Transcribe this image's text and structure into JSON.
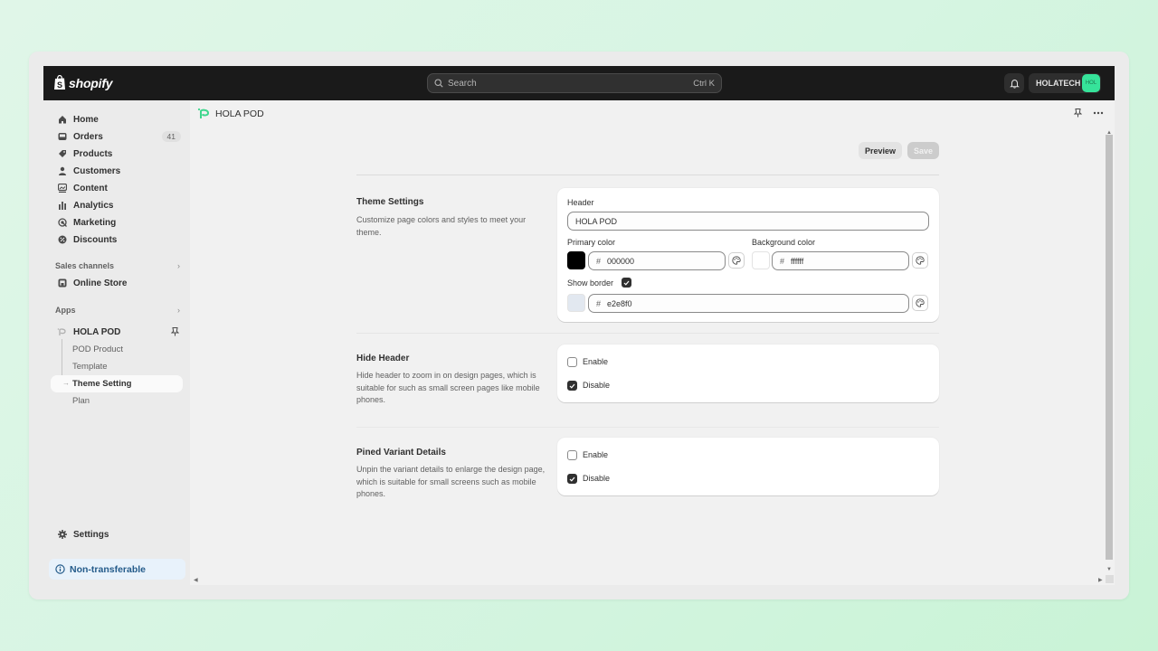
{
  "topbar": {
    "brand": "shopify",
    "search_placeholder": "Search",
    "search_shortcut": "Ctrl K",
    "account_name": "HOLATECH",
    "account_avatar": "HOL",
    "bell_icon": "bell-icon"
  },
  "sidebar": {
    "items": [
      {
        "label": "Home",
        "icon": "home-icon"
      },
      {
        "label": "Orders",
        "icon": "inbox-icon",
        "badge": "41"
      },
      {
        "label": "Products",
        "icon": "tag-icon"
      },
      {
        "label": "Customers",
        "icon": "person-icon"
      },
      {
        "label": "Content",
        "icon": "image-icon"
      },
      {
        "label": "Analytics",
        "icon": "bar-chart-icon"
      },
      {
        "label": "Marketing",
        "icon": "target-icon"
      },
      {
        "label": "Discounts",
        "icon": "discount-icon"
      }
    ],
    "sales_channels_label": "Sales channels",
    "online_store_label": "Online Store",
    "apps_label": "Apps",
    "app_name": "HOLA POD",
    "app_subitems": [
      "POD Product",
      "Template",
      "Theme Setting",
      "Plan"
    ],
    "active_subitem": "Theme Setting",
    "settings_label": "Settings",
    "notice_label": "Non-transferable"
  },
  "main": {
    "app_title": "HOLA POD",
    "preview_label": "Preview",
    "save_label": "Save",
    "theme": {
      "title": "Theme Settings",
      "description": "Customize page colors and styles to meet your theme.",
      "header_label": "Header",
      "header_value": "HOLA POD",
      "primary_label": "Primary color",
      "primary_value": "000000",
      "primary_swatch": "#000000",
      "background_label": "Background color",
      "background_value": "ffffff",
      "background_swatch": "#ffffff",
      "show_border_label": "Show border",
      "show_border_checked": true,
      "border_value": "e2e8f0",
      "border_swatch": "#e2e8f0",
      "hash": "#"
    },
    "hide_header": {
      "title": "Hide Header",
      "description": "Hide header to zoom in on design pages, which is suitable for such as small screen pages like mobile phones.",
      "options": [
        {
          "label": "Enable",
          "checked": false
        },
        {
          "label": "Disable",
          "checked": true
        }
      ]
    },
    "pinned_variant": {
      "title": "Pined Variant Details",
      "description": "Unpin the variant details to enlarge the design page, which is suitable for small screens such as mobile phones.",
      "options": [
        {
          "label": "Enable",
          "checked": false
        },
        {
          "label": "Disable",
          "checked": true
        }
      ]
    }
  },
  "colors": {
    "topbar_bg": "#1a1a1a",
    "avatar_bg": "#36e39a",
    "notice_text": "#245b8a",
    "checkbox_checked": "#303030"
  }
}
